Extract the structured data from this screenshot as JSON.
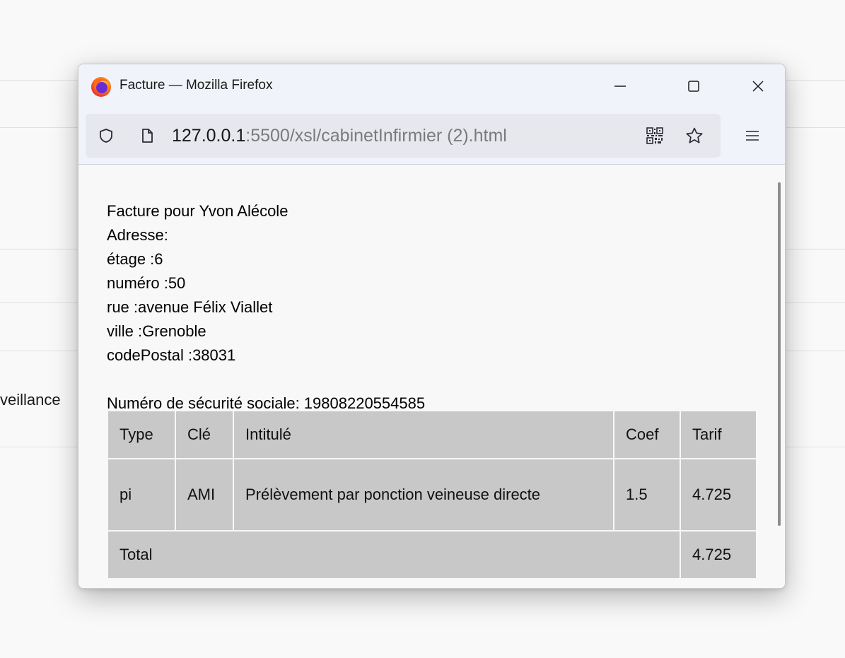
{
  "window": {
    "title": "Facture — Mozilla Firefox"
  },
  "urlbar": {
    "host": "127.0.0.1",
    "rest": ":5500/xsl/cabinetInfirmier (2).html"
  },
  "background": {
    "partial_text": "veillance"
  },
  "invoice": {
    "heading": "Facture pour Yvon Alécole",
    "address_label": "Adresse:",
    "address_lines": [
      "étage :6",
      "numéro :50",
      "rue :avenue Félix Viallet",
      "ville :Grenoble",
      "codePostal :38031"
    ],
    "ssn": "Numéro de sécurité sociale: 19808220554585",
    "table": {
      "headers": [
        "Type",
        "Clé",
        "Intitulé",
        "Coef",
        "Tarif"
      ],
      "rows": [
        [
          "pi",
          "AMI",
          "Prélèvement par ponction veineuse directe",
          "1.5",
          "4.725"
        ]
      ],
      "total_label": "Total",
      "total_value": "4.725"
    }
  },
  "icons": {
    "app": "firefox-icon",
    "minimize": "minimize-icon",
    "maximize": "maximize-icon",
    "close": "close-icon",
    "tracking": "shield-icon",
    "page": "page-icon",
    "qr": "qr-code-icon",
    "bookmark": "star-icon",
    "menu": "hamburger-menu-icon"
  }
}
